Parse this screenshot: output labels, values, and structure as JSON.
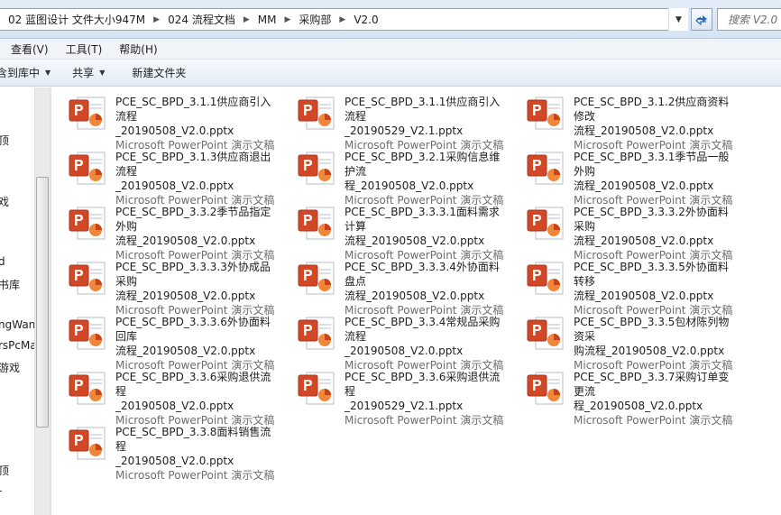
{
  "address_bar": {
    "crumbs": [
      "02 蓝图设计 文件大小947M",
      "024 流程文档",
      "MM",
      "采购部",
      "V2.0"
    ]
  },
  "search": {
    "placeholder": "搜索 V2.0"
  },
  "menu": {
    "items": [
      "查看(V)",
      "工具(T)",
      "帮助(H)"
    ]
  },
  "toolbar": {
    "include_library": "含到库中",
    "share": "共享",
    "new_folder": "新建文件夹"
  },
  "nav": {
    "items": [
      "顶",
      "戏",
      "d",
      "书库",
      "ngWan",
      "rsPcMa",
      "游戏",
      "顶",
      "‑"
    ]
  },
  "file_type_label": "Microsoft PowerPoint 演示文稿",
  "files": [
    {
      "name_line1": "PCE_SC_BPD_3.1.1供应商引入流程",
      "name_line2": "_20190508_V2.0.pptx"
    },
    {
      "name_line1": "PCE_SC_BPD_3.1.1供应商引入流程",
      "name_line2": "_20190529_V2.1.pptx"
    },
    {
      "name_line1": "PCE_SC_BPD_3.1.2供应商资料修改",
      "name_line2": "流程_20190508_V2.0.pptx"
    },
    {
      "name_line1": "PCE_SC_BPD_3.1.3供应商退出流程",
      "name_line2": "_20190508_V2.0.pptx"
    },
    {
      "name_line1": "PCE_SC_BPD_3.2.1采购信息维护流",
      "name_line2": "程_20190508_V2.0.pptx"
    },
    {
      "name_line1": "PCE_SC_BPD_3.3.1季节品一般外购",
      "name_line2": "流程_20190508_V2.0.pptx"
    },
    {
      "name_line1": "PCE_SC_BPD_3.3.2季节品指定外购",
      "name_line2": "流程_20190508_V2.0.pptx"
    },
    {
      "name_line1": "PCE_SC_BPD_3.3.3.1面料需求计算",
      "name_line2": "流程_20190508_V2.0.pptx"
    },
    {
      "name_line1": "PCE_SC_BPD_3.3.3.2外协面料采购",
      "name_line2": "流程_20190508_V2.0.pptx"
    },
    {
      "name_line1": "PCE_SC_BPD_3.3.3.3外协成品采购",
      "name_line2": "流程_20190508_V2.0.pptx"
    },
    {
      "name_line1": "PCE_SC_BPD_3.3.3.4外协面料盘点",
      "name_line2": "流程_20190508_V2.0.pptx"
    },
    {
      "name_line1": "PCE_SC_BPD_3.3.3.5外协面料转移",
      "name_line2": "流程_20190508_V2.0.pptx"
    },
    {
      "name_line1": "PCE_SC_BPD_3.3.3.6外协面料回库",
      "name_line2": "流程_20190508_V2.0.pptx"
    },
    {
      "name_line1": "PCE_SC_BPD_3.3.4常规品采购流程",
      "name_line2": "_20190508_V2.0.pptx"
    },
    {
      "name_line1": "PCE_SC_BPD_3.3.5包材陈列物资采",
      "name_line2": "购流程_20190508_V2.0.pptx"
    },
    {
      "name_line1": "PCE_SC_BPD_3.3.6采购退供流程",
      "name_line2": "_20190508_V2.0.pptx"
    },
    {
      "name_line1": "PCE_SC_BPD_3.3.6采购退供流程",
      "name_line2": "_20190529_V2.1.pptx"
    },
    {
      "name_line1": "PCE_SC_BPD_3.3.7采购订单变更流",
      "name_line2": "程_20190508_V2.0.pptx"
    },
    {
      "name_line1": "PCE_SC_BPD_3.3.8面料销售流程",
      "name_line2": "_20190508_V2.0.pptx"
    }
  ]
}
